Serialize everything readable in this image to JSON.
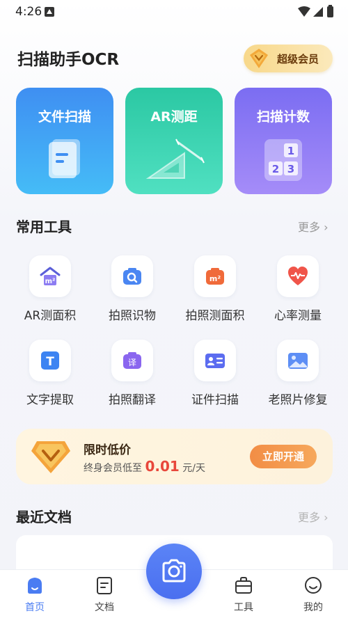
{
  "status": {
    "time": "4:26"
  },
  "header": {
    "title": "扫描助手OCR",
    "vip_label": "超级会员"
  },
  "feature_cards": [
    {
      "title": "文件扫描",
      "icon": "document-scan-icon"
    },
    {
      "title": "AR测距",
      "icon": "ruler-triangle-icon"
    },
    {
      "title": "扫描计数",
      "icon": "number-grid-icon",
      "numbers": [
        "1",
        "2",
        "3"
      ]
    }
  ],
  "tools_section": {
    "title": "常用工具",
    "more": "更多 ›",
    "items": [
      {
        "label": "AR测面积",
        "icon": "house-area-icon",
        "badge": "m²"
      },
      {
        "label": "拍照识物",
        "icon": "camera-search-icon"
      },
      {
        "label": "拍照测面积",
        "icon": "camera-area-icon",
        "badge": "m²"
      },
      {
        "label": "心率测量",
        "icon": "heart-rate-icon"
      },
      {
        "label": "文字提取",
        "icon": "text-extract-icon",
        "badge": "T"
      },
      {
        "label": "拍照翻译",
        "icon": "camera-translate-icon",
        "badge": "译"
      },
      {
        "label": "证件扫描",
        "icon": "id-card-icon"
      },
      {
        "label": "老照片修复",
        "icon": "photo-restore-icon"
      }
    ]
  },
  "promo": {
    "title": "限时低价",
    "subtitle_prefix": "终身会员低至",
    "price": "0.01",
    "unit": "元/天",
    "button": "立即开通"
  },
  "recent_section": {
    "title": "最近文档",
    "more": "更多 ›"
  },
  "tabbar": {
    "items": [
      {
        "label": "首页",
        "icon": "home-icon",
        "active": true
      },
      {
        "label": "文档",
        "icon": "document-icon",
        "active": false
      },
      {
        "label": "工具",
        "icon": "toolbox-icon",
        "active": false
      },
      {
        "label": "我的",
        "icon": "profile-icon",
        "active": false
      }
    ],
    "center_icon": "camera-icon"
  },
  "colors": {
    "accent": "#4a7cf2",
    "card_blue": "#3f8ff2",
    "card_green": "#2bc8a3",
    "card_purple": "#7b6df2",
    "price_red": "#e8473b",
    "promo_orange": "#f28d45"
  }
}
